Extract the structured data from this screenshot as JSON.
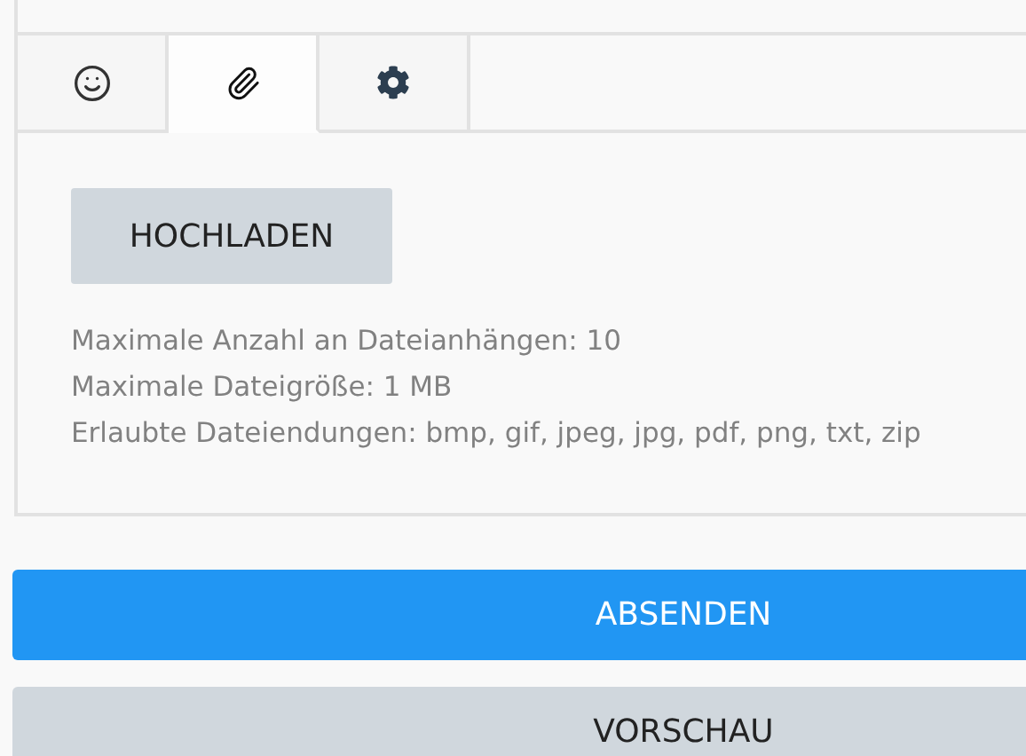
{
  "tabs": [
    {
      "selected": false
    },
    {
      "selected": true
    },
    {
      "selected": false
    }
  ],
  "upload_button": "HOCHLADEN",
  "info_lines": [
    "Maximale Anzahl an Dateianhängen: 10",
    "Maximale Dateigröße: 1 MB",
    "Erlaubte Dateiendungen: bmp, gif, jpeg, jpg, pdf, png, txt, zip"
  ],
  "buttons": [
    {
      "label": "ABSENDEN",
      "kind": "primary"
    },
    {
      "label": "VORSCHAU",
      "kind": "secondary"
    }
  ]
}
